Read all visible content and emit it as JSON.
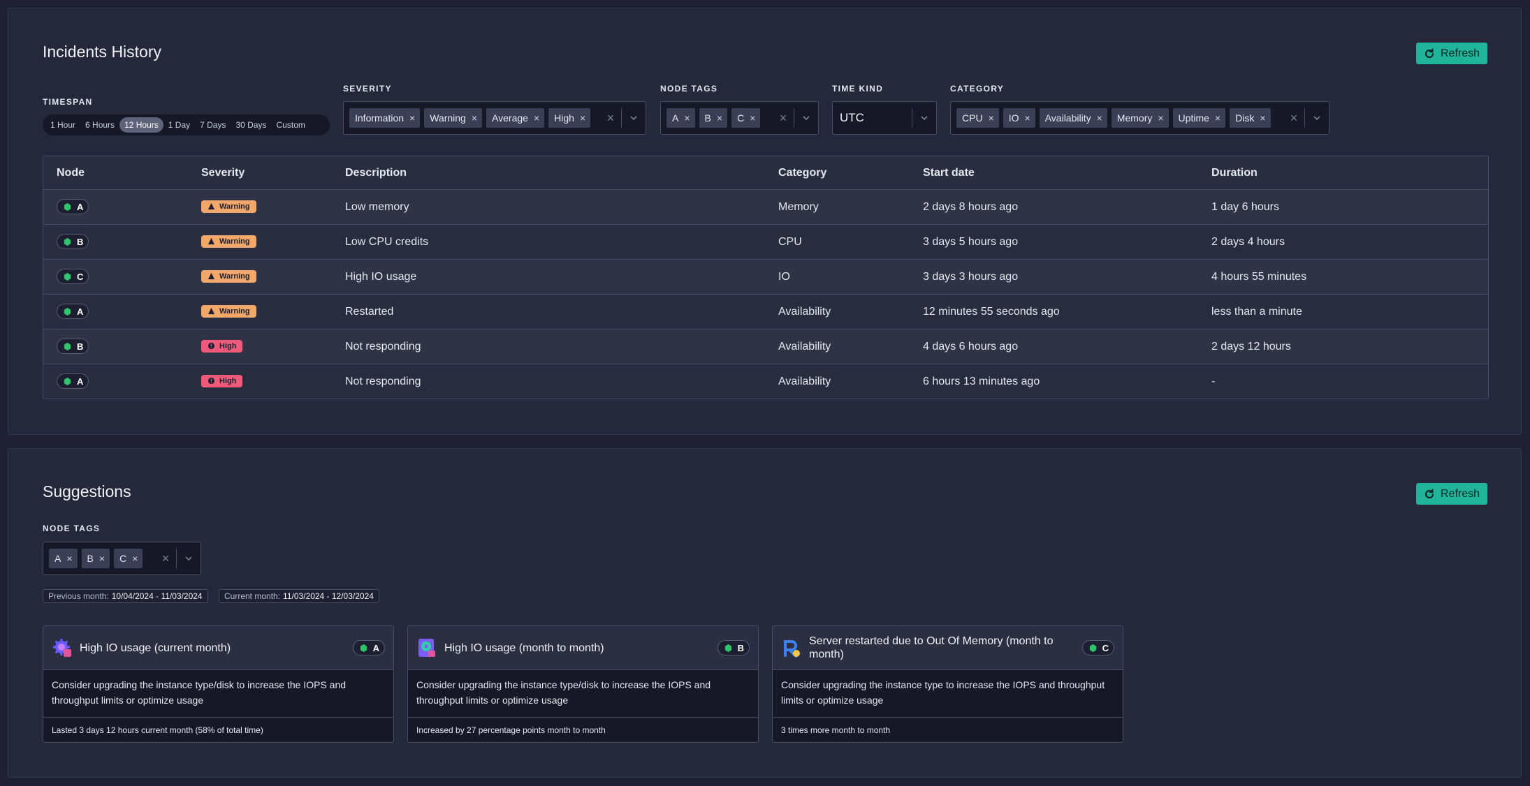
{
  "incidents": {
    "title": "Incidents History",
    "refresh_label": "Refresh",
    "timespan": {
      "label": "TIMESPAN",
      "options": [
        "1 Hour",
        "6 Hours",
        "12 Hours",
        "1 Day",
        "7 Days",
        "30 Days",
        "Custom"
      ],
      "selected": "12 Hours"
    },
    "severity": {
      "label": "SEVERITY",
      "chips": [
        "Information",
        "Warning",
        "Average",
        "High"
      ]
    },
    "node_tags": {
      "label": "NODE TAGS",
      "chips": [
        "A",
        "B",
        "C"
      ]
    },
    "time_kind": {
      "label": "TIME KIND",
      "value": "UTC"
    },
    "category": {
      "label": "CATEGORY",
      "chips": [
        "CPU",
        "IO",
        "Availability",
        "Memory",
        "Uptime",
        "Disk"
      ]
    },
    "table": {
      "columns": [
        "Node",
        "Severity",
        "Description",
        "Category",
        "Start date",
        "Duration"
      ],
      "rows": [
        {
          "node": "A",
          "severity": "Warning",
          "description": "Low memory",
          "category": "Memory",
          "start": "2 days 8 hours ago",
          "duration": "1 day 6 hours"
        },
        {
          "node": "B",
          "severity": "Warning",
          "description": "Low CPU credits",
          "category": "CPU",
          "start": "3 days 5 hours ago",
          "duration": "2 days 4 hours"
        },
        {
          "node": "C",
          "severity": "Warning",
          "description": "High IO usage",
          "category": "IO",
          "start": "3 days 3 hours ago",
          "duration": "4 hours 55 minutes"
        },
        {
          "node": "A",
          "severity": "Warning",
          "description": "Restarted",
          "category": "Availability",
          "start": "12 minutes 55 seconds ago",
          "duration": "less than a minute"
        },
        {
          "node": "B",
          "severity": "High",
          "description": "Not responding",
          "category": "Availability",
          "start": "4 days 6 hours ago",
          "duration": "2 days 12 hours"
        },
        {
          "node": "A",
          "severity": "High",
          "description": "Not responding",
          "category": "Availability",
          "start": "6 hours 13 minutes ago",
          "duration": "-"
        }
      ]
    }
  },
  "suggestions": {
    "title": "Suggestions",
    "refresh_label": "Refresh",
    "node_tags": {
      "label": "NODE TAGS",
      "chips": [
        "A",
        "B",
        "C"
      ]
    },
    "previous_month": {
      "label": "Previous month:",
      "value": "10/04/2024 - 11/03/2024"
    },
    "current_month": {
      "label": "Current month:",
      "value": "11/03/2024 - 12/03/2024"
    },
    "cards": [
      {
        "icon": "gear-chip-icon",
        "title": "High IO usage (current month)",
        "node": "A",
        "body": "Consider upgrading the instance type/disk to increase the IOPS and throughput limits or optimize usage",
        "footer": "Lasted 3 days 12 hours current month (58% of total time)"
      },
      {
        "icon": "disk-icon",
        "title": "High IO usage (month to month)",
        "node": "B",
        "body": "Consider upgrading the instance type/disk to increase the IOPS and throughput limits or optimize usage",
        "footer": "Increased by 27 percentage points month to month"
      },
      {
        "icon": "restart-icon",
        "title": "Server restarted due to Out Of Memory (month to month)",
        "node": "C",
        "body": "Consider upgrading the instance type to increase the IOPS and throughput limits or optimize usage",
        "footer": "3 times more month to month"
      }
    ]
  },
  "colors": {
    "accent": "#20b59b",
    "warning": "#f2a76b",
    "high": "#f05a7a",
    "node_green": "#2fc46b"
  }
}
